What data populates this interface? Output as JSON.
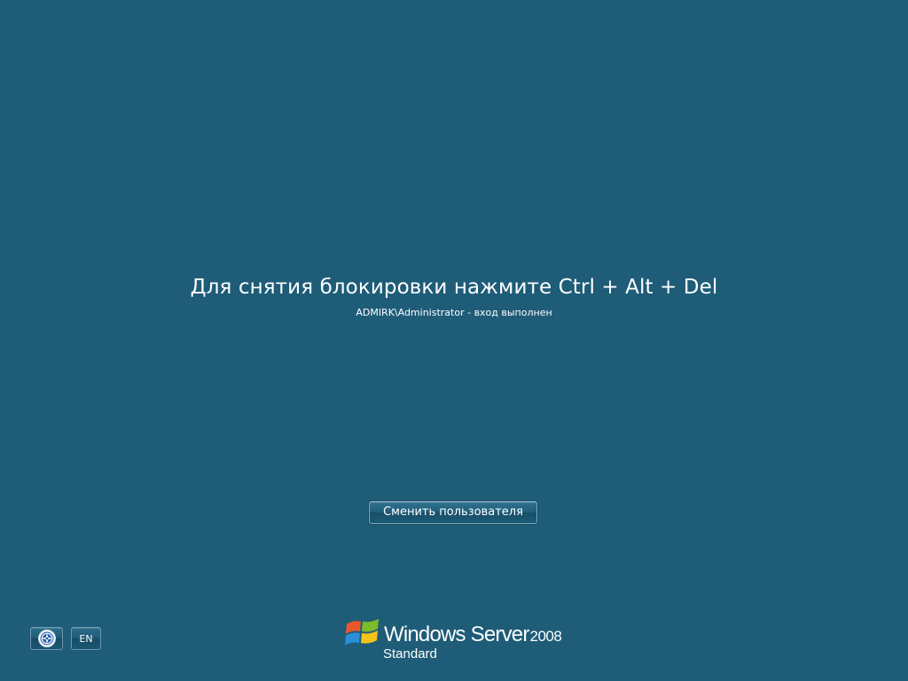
{
  "lock_screen": {
    "message": "Для снятия блокировки нажмите Ctrl + Alt + Del",
    "status": "ADMIRK\\Administrator - вход выполнен",
    "switch_user_label": "Сменить пользователя"
  },
  "corner_controls": {
    "ease_of_access_icon": "ease-of-access-icon",
    "language_label": "EN"
  },
  "branding": {
    "logo_icon": "windows-flag-icon",
    "product_name": "Windows Server",
    "version": "2008",
    "edition": "Standard"
  },
  "colors": {
    "background": "#1e5c78",
    "text": "#ffffff",
    "button_border": "#7ea7bd"
  }
}
